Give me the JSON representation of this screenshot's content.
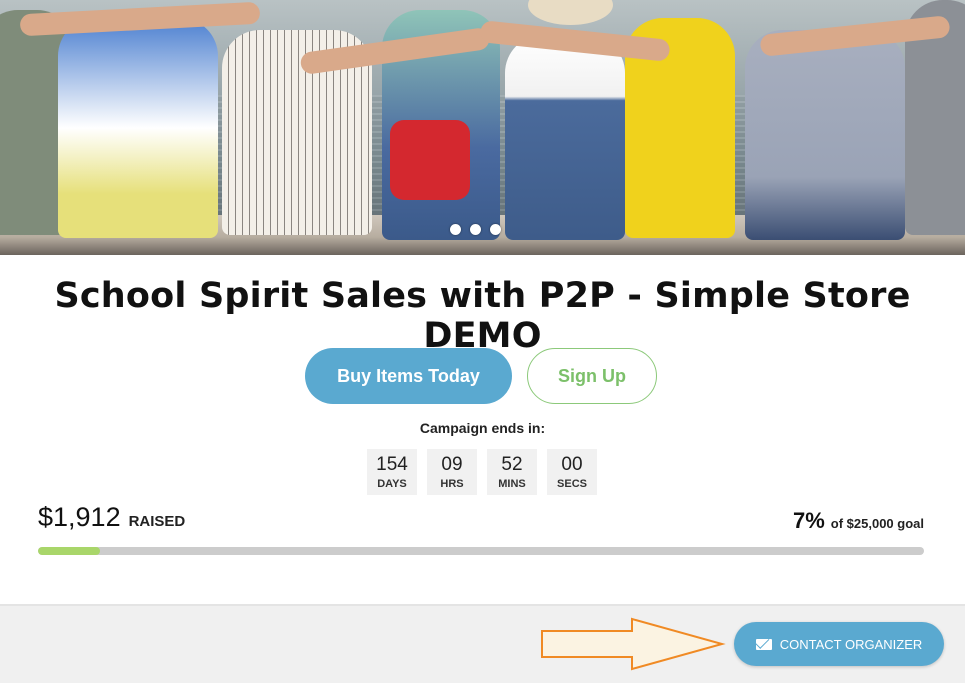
{
  "hero": {
    "carousel_dots": 3,
    "active_dot": 2
  },
  "campaign": {
    "title": "School Spirit Sales with P2P - Simple Store DEMO"
  },
  "actions": {
    "buy_label": "Buy Items Today",
    "signup_label": "Sign Up"
  },
  "countdown": {
    "heading": "Campaign ends in:",
    "units": [
      {
        "value": "154",
        "label": "DAYS"
      },
      {
        "value": "09",
        "label": "HRS"
      },
      {
        "value": "52",
        "label": "MINS"
      },
      {
        "value": "00",
        "label": "SECS"
      }
    ]
  },
  "fundraising": {
    "raised_amount": "$1,912",
    "raised_label": "RAISED",
    "percent": "7%",
    "goal_text": "of $25,000 goal",
    "progress_fraction": 0.07
  },
  "footer": {
    "contact_label": "CONTACT ORGANIZER",
    "contact_icon": "envelope-icon"
  },
  "colors": {
    "primary_blue": "#5aa9d0",
    "accent_green": "#7cc06a",
    "progress_green": "#a9d66a",
    "arrow_orange": "#f08a24"
  }
}
